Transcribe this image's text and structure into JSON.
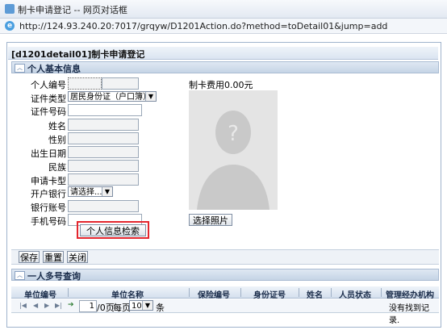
{
  "window": {
    "title": "制卡申请登记 -- 网页对话框"
  },
  "address": {
    "url": "http://124.93.240.20:7017/grqyw/D1201Action.do?method=toDetail01&jump=add"
  },
  "page": {
    "title": "[d1201detail01]制卡申请登记"
  },
  "sections": {
    "basic": "个人基本信息",
    "multi": "一人多号查询"
  },
  "form": {
    "personal_id": "个人编号",
    "id_type": "证件类型",
    "id_type_value": "居民身份证（户口簿）",
    "id_number": "证件号码",
    "name": "姓名",
    "gender": "性别",
    "birth_date": "出生日期",
    "ethnicity": "民族",
    "card_type": "申请卡型",
    "bank": "开户银行",
    "bank_value": "请选择...",
    "bank_account": "银行账号",
    "phone": "手机号码",
    "search_button": "个人信息检索"
  },
  "fee": {
    "label": "制卡费用",
    "value": "0.00元"
  },
  "photo": {
    "select_button": "选择照片"
  },
  "toolbar": {
    "save": "保存",
    "reset": "重置",
    "close": "关闭"
  },
  "table": {
    "headers": [
      "单位编号",
      "单位名称",
      "保险编号",
      "身份证号",
      "姓名",
      "人员状态",
      "管理经办机构"
    ],
    "pager": {
      "page_value": "1",
      "total_pages": "/0页",
      "per_page_prefix": "每页",
      "per_page_value": "10",
      "per_page_suffix": "条",
      "empty": "没有找到记录."
    }
  }
}
